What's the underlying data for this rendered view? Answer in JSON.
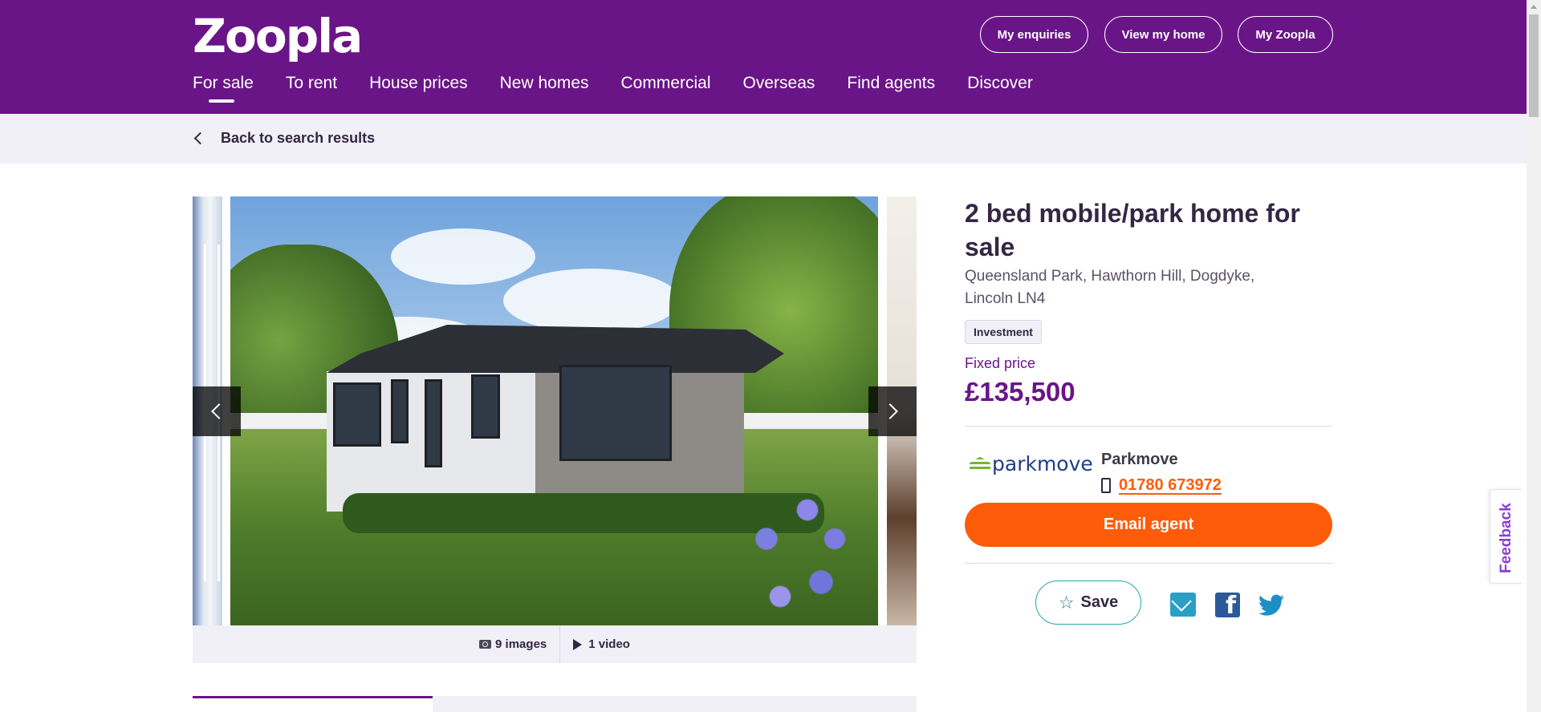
{
  "header": {
    "logo": "Zoopla",
    "buttons": [
      "My enquiries",
      "View my home",
      "My Zoopla"
    ],
    "nav": [
      "For sale",
      "To rent",
      "House prices",
      "New homes",
      "Commercial",
      "Overseas",
      "Find agents",
      "Discover"
    ],
    "active_nav": "For sale"
  },
  "subbar": {
    "back_label": "Back to search results"
  },
  "gallery": {
    "images_label": "9 images",
    "video_label": "1 video"
  },
  "listing": {
    "title": "2 bed mobile/park home for sale",
    "address": "Queensland Park, Hawthorn Hill, Dogdyke, Lincoln LN4",
    "badge": "Investment",
    "price_label": "Fixed price",
    "price": "£135,500"
  },
  "agent": {
    "logo_text": "parkmove",
    "name": "Parkmove",
    "phone": "01780 673972",
    "email_button": "Email agent"
  },
  "actions": {
    "save_label": "Save"
  },
  "feedback": {
    "label": "Feedback"
  },
  "colors": {
    "brand_purple": "#6a1587",
    "accent_orange": "#ff5c0a",
    "teal": "#2aa6a6"
  },
  "icons": [
    "chevron-left-icon",
    "camera-icon",
    "play-icon",
    "phone-icon",
    "star-icon",
    "mail-icon",
    "facebook-icon",
    "twitter-icon"
  ]
}
